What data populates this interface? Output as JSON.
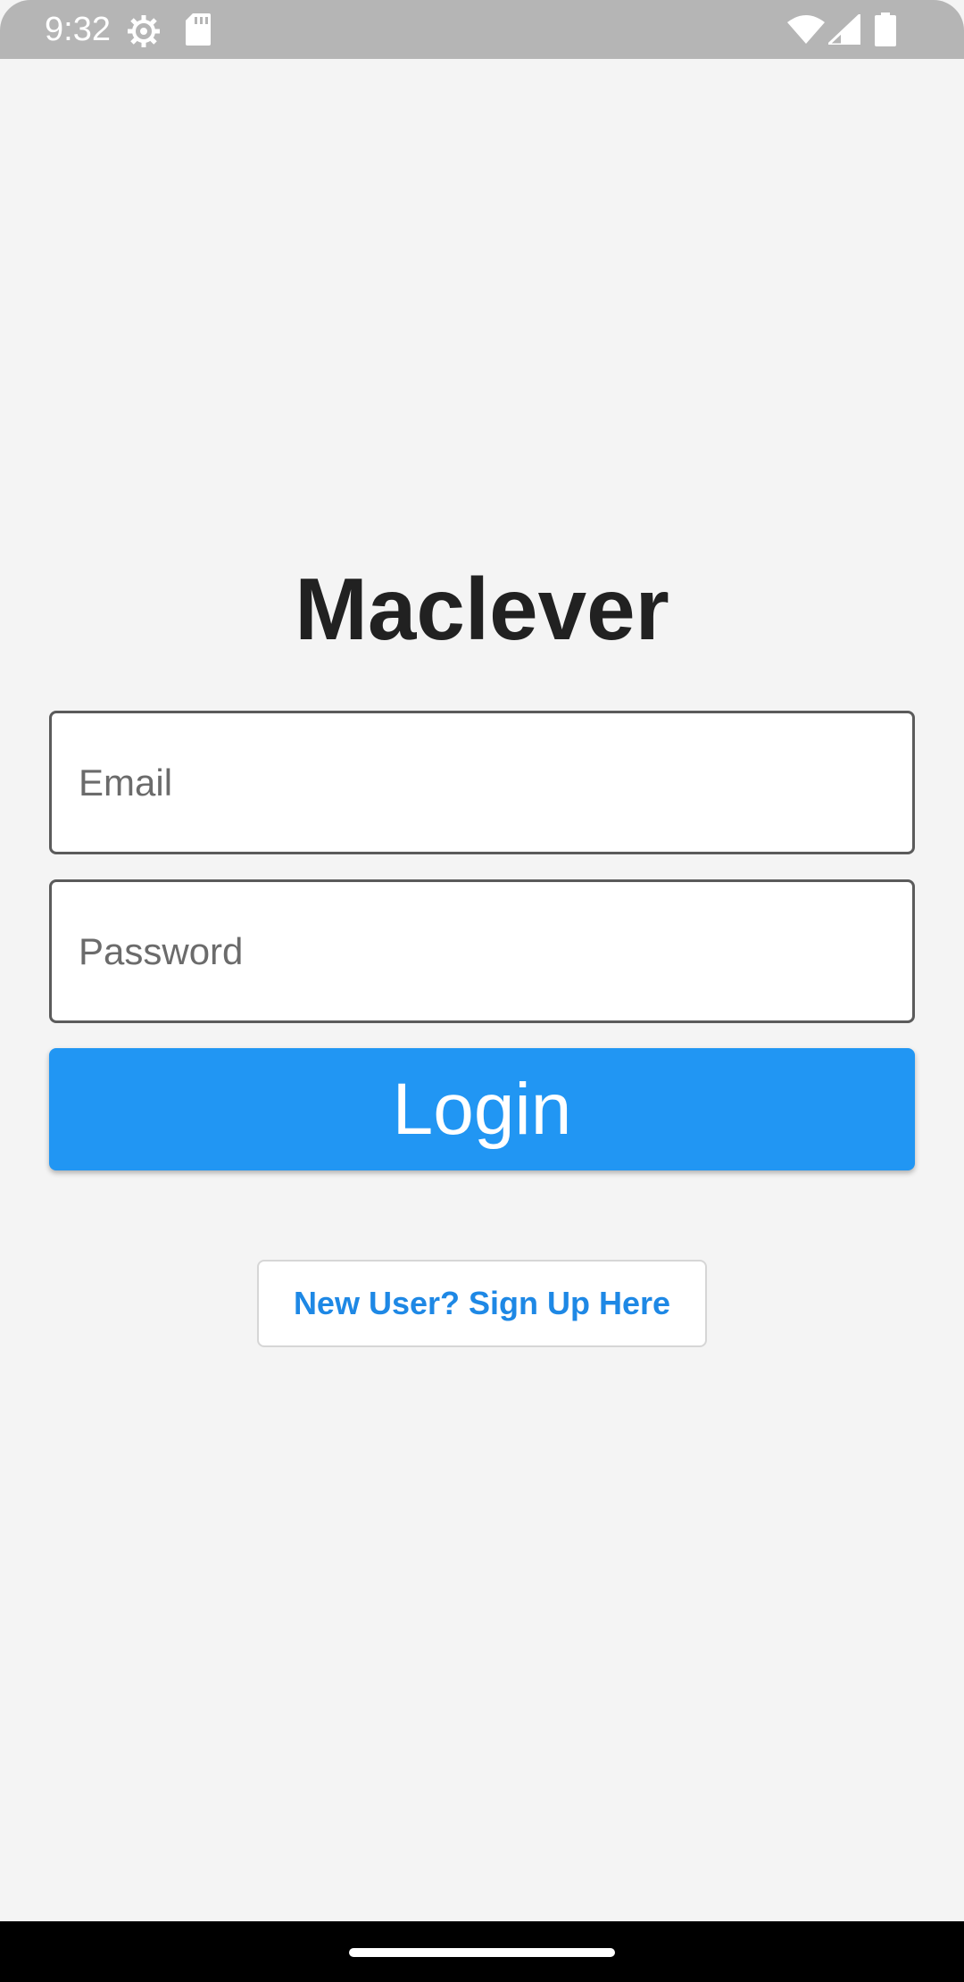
{
  "status_bar": {
    "time": "9:32",
    "icons": [
      "gear-icon",
      "sd-card-icon",
      "wifi-icon",
      "signal-icon",
      "battery-icon"
    ]
  },
  "app": {
    "title": "Maclever"
  },
  "form": {
    "email_placeholder": "Email",
    "email_value": "",
    "password_placeholder": "Password",
    "password_value": "",
    "login_label": "Login",
    "signup_label": "New User? Sign Up Here"
  },
  "colors": {
    "primary": "#2196f3",
    "link": "#1e88e5",
    "background": "#f4f4f4",
    "status_bar": "#b5b5b5",
    "title_text": "#212121"
  }
}
